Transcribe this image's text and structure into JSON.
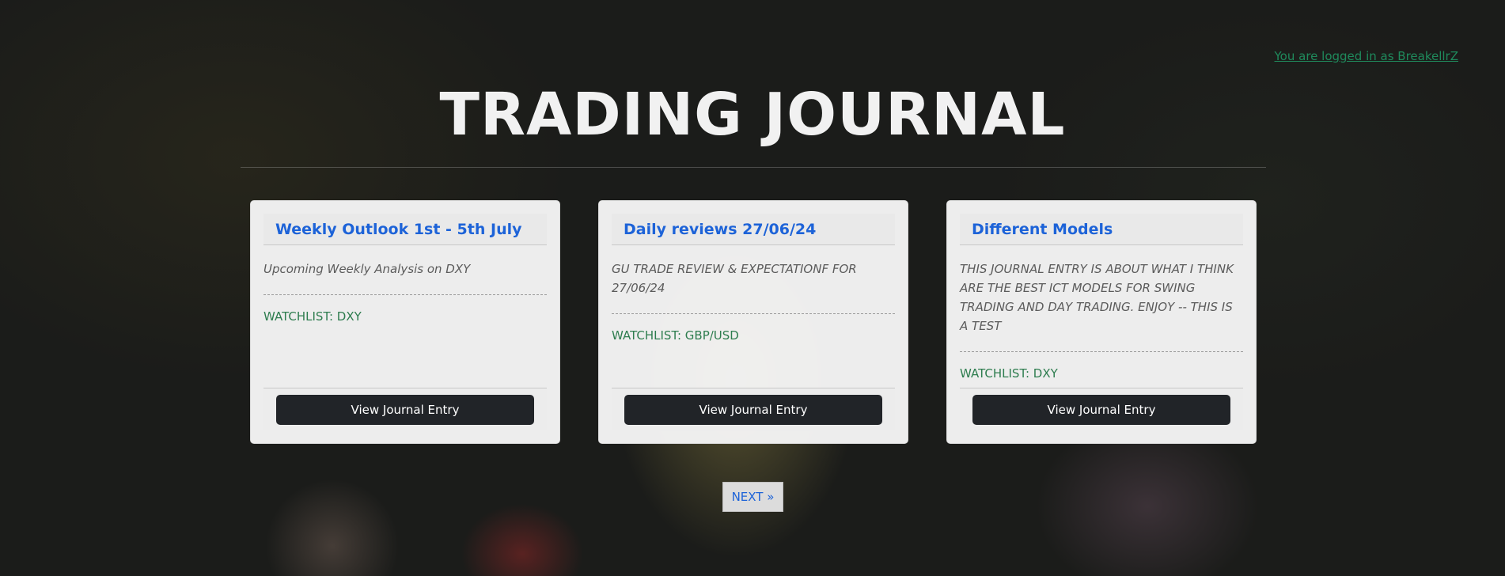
{
  "header": {
    "login_text": "You are logged in as BreakellrZ",
    "title": "TRADING JOURNAL"
  },
  "cards": [
    {
      "title": "Weekly Outlook 1st - 5th July",
      "description": "Upcoming Weekly Analysis on DXY",
      "watchlist": "WATCHLIST: DXY",
      "button_label": "View Journal Entry"
    },
    {
      "title": "Daily reviews 27/06/24",
      "description": "GU TRADE REVIEW & EXPECTATIONF FOR 27/06/24",
      "watchlist": "WATCHLIST: GBP/USD",
      "button_label": "View Journal Entry"
    },
    {
      "title": "Different Models",
      "description": "THIS JOURNAL ENTRY IS ABOUT WHAT I THINK ARE THE BEST ICT MODELS FOR SWING TRADING AND DAY TRADING. ENJOY -- THIS IS A TEST",
      "watchlist": "WATCHLIST: DXY",
      "button_label": "View Journal Entry"
    }
  ],
  "pagination": {
    "next_label": "NEXT »"
  },
  "colors": {
    "title_link": "#1d63d8",
    "watchlist_text": "#2e7d4f",
    "login_link": "#1f8a5c",
    "button_bg": "#212428"
  }
}
